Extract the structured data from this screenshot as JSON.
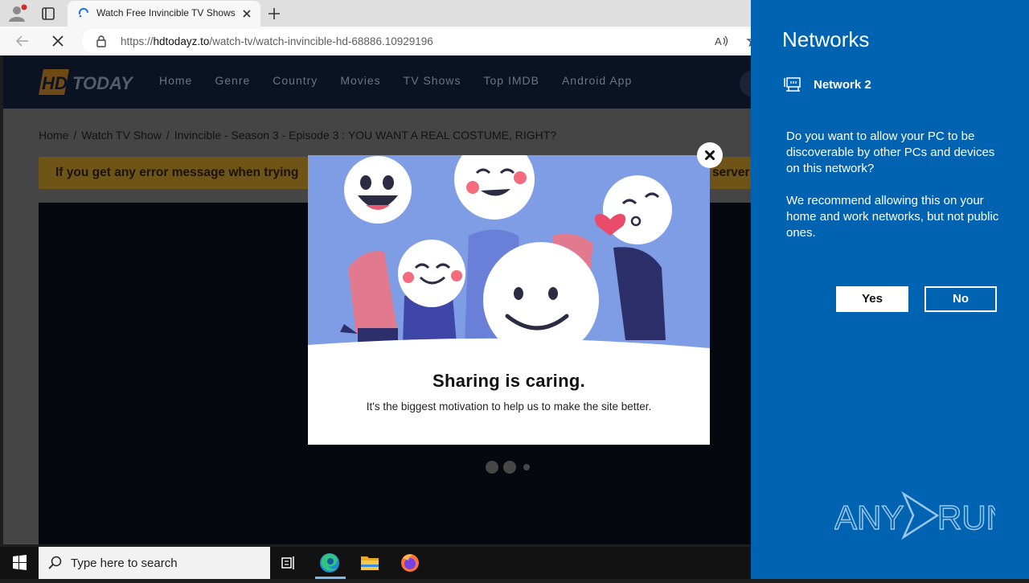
{
  "browser": {
    "tab_title": "Watch Free Invincible TV Shows Online",
    "url_prefix": "https://",
    "url_host": "hdtodayz.to",
    "url_path": "/watch-tv/watch-invincible-hd-68886.10929196"
  },
  "site": {
    "logo_text": "HD TODAY",
    "nav": [
      "Home",
      "Genre",
      "Country",
      "Movies",
      "TV Shows",
      "Top IMDB",
      "Android App"
    ],
    "breadcrumb": {
      "home": "Home",
      "sep": "/",
      "section": "Watch TV Show",
      "current": "Invincible - Season 3 - Episode 3 : YOU WANT A REAL COSTUME, RIGHT?"
    },
    "warning_left": "If you get any error message when trying",
    "warning_right": "server"
  },
  "modal": {
    "title": "Sharing is caring.",
    "subtitle": "It's the biggest motivation to help us to make the site better.",
    "close_glyph": "×"
  },
  "networks_panel": {
    "title": "Networks",
    "network_name": "Network 2",
    "question": "Do you want to allow your PC to be discoverable by other PCs and devices on this network?",
    "recommendation": "We recommend allowing this on your home and work networks, but not public ones.",
    "yes_label": "Yes",
    "no_label": "No",
    "watermark": "ANY RUN",
    "bg_color": "#0063b1"
  },
  "taskbar": {
    "search_placeholder": "Type here to search",
    "apps": [
      "task-view",
      "edge",
      "file-explorer",
      "firefox"
    ]
  }
}
